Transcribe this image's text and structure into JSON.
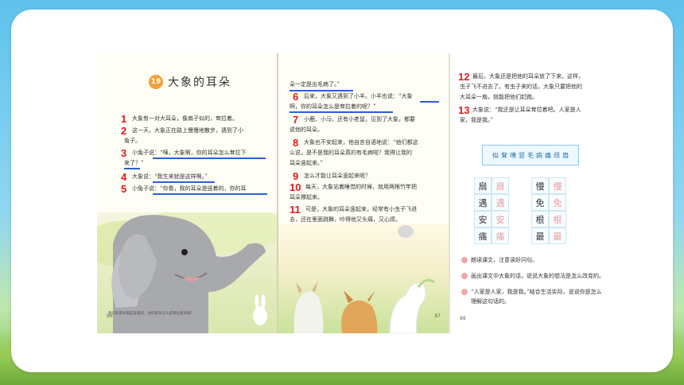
{
  "lesson": {
    "number": "19",
    "title": "大象的耳朵"
  },
  "page_numbers": {
    "left": "86",
    "middle": "87",
    "right": "88"
  },
  "page1": {
    "p1": "大象有一对大耳朵，像扇子似的，耷拉着。",
    "p2a": "这一天，大象正在路上慢慢地散步，遇到了小",
    "p2b": "兔子。",
    "p3a": "小兔子说：“咦，大象啊，你的耳朵怎么耷拉下",
    "p3b": "来了？”",
    "p4": "大象说：“我生来就是这样啊。”",
    "p5a": "小兔子说：“你看，我的耳朵是竖着的，你的耳",
    "caption": "我们的耳朵都是竖着的，你的耳朵怎么是耷拉着的呢？"
  },
  "page2": {
    "top": "朵一定是出毛病了。”",
    "p6a": "后来，大象又遇到了小羊。小羊也说：“大象",
    "p6b": "啊，你的耳朵怎么是耷拉着的呢？”",
    "p7a": "小鹿、小马，还有小老鼠，见到了大象，都要",
    "p7b": "说他的耳朵。",
    "p8a": "大象也不安起来，他自言自语地说：“他们都这",
    "p8b": "么说，是不是我的耳朵真的有毛病啦？我得让我的",
    "p8c": "耳朵竖起来。”",
    "p9": "怎么才能让耳朵竖起来呢？",
    "p10a": "每天，大象站着睡觉的时候，就用两根竹竿把",
    "p10b": "耳朵撑起来。",
    "p11a": "可是，大象的耳朵竖起来，经常有小虫子飞进",
    "p11b": "去，还在里面跳舞，吵得他又头痛，又心烦。"
  },
  "page3": {
    "p12a": "最后，大象还是把他的耳朵放了下来。这样，",
    "p12b": "虫子飞不进去了。有虫子来的话，大象只要把他的",
    "p12c": "大耳朵一扇，就能把他们赶跑。",
    "p13a": "大象说：“我还是让耳朵耷拉着吧。人家是人",
    "p13b": "家，我是我。”",
    "vocab": [
      "似",
      "耷",
      "咦",
      "竖",
      "毛",
      "病",
      "痛",
      "烦",
      "扇"
    ],
    "grid": [
      [
        "扇",
        "扇",
        "",
        "慢",
        "慢"
      ],
      [
        "遇",
        "遇",
        "",
        "免",
        "免"
      ],
      [
        "安",
        "安",
        "",
        "根",
        "根"
      ],
      [
        "痛",
        "痛",
        "",
        "最",
        "最"
      ]
    ],
    "q1": "朗读课文，注意读好问句。",
    "q2": "画出课文中大象的话，说说大象的想法是怎么改变的。",
    "q3a": "“人家是人家，我是我。”结合生活实际，说说你是怎么",
    "q3b": "理解这句话的。"
  },
  "markers": [
    "1",
    "2",
    "3",
    "4",
    "5",
    "6",
    "7",
    "8",
    "9",
    "10",
    "11",
    "12",
    "13"
  ],
  "colors": {
    "marker": "#e21a1a",
    "underline": "#2a5fd8",
    "lesson_badge": "#f0a13a"
  }
}
